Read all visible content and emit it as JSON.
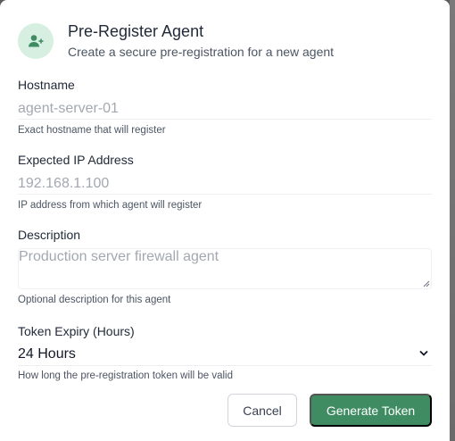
{
  "dialog": {
    "title": "Pre-Register Agent",
    "subtitle": "Create a secure pre-registration for a new agent",
    "icon": "user-plus-icon",
    "accent_color": "#3f8c63"
  },
  "fields": {
    "hostname": {
      "label": "Hostname",
      "value": "",
      "placeholder": "agent-server-01",
      "help": "Exact hostname that will register"
    },
    "ip": {
      "label": "Expected IP Address",
      "value": "",
      "placeholder": "192.168.1.100",
      "help": "IP address from which agent will register"
    },
    "description": {
      "label": "Description",
      "value": "",
      "placeholder": "Production server firewall agent",
      "help": "Optional description for this agent"
    },
    "expiry": {
      "label": "Token Expiry (Hours)",
      "selected": "24 Hours",
      "help": "How long the pre-registration token will be valid"
    }
  },
  "actions": {
    "cancel_label": "Cancel",
    "submit_label": "Generate Token"
  }
}
